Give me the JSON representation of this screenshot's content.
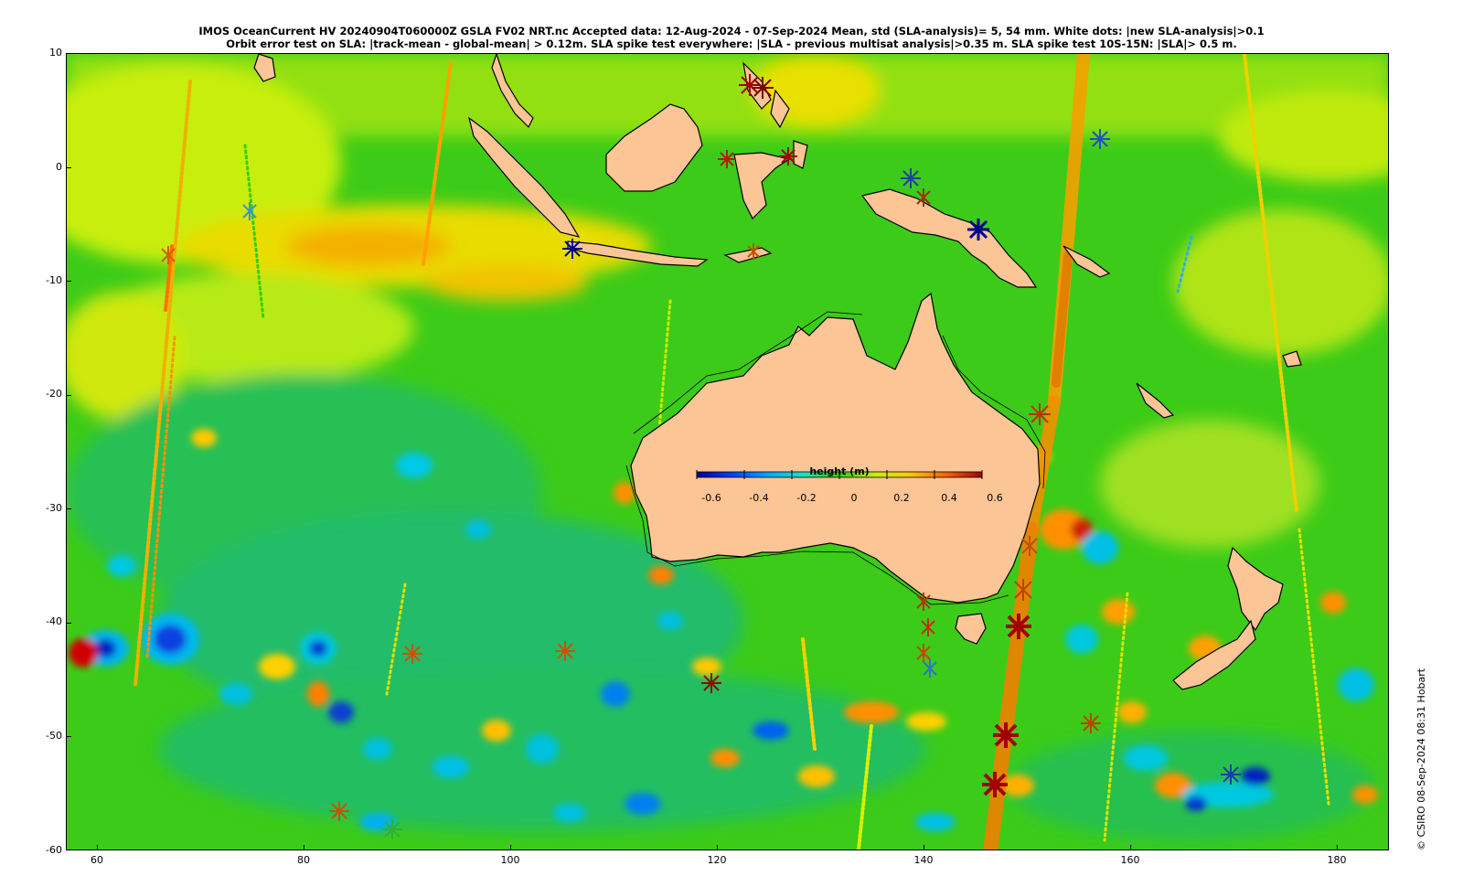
{
  "header": {
    "line1": "IMOS OceanCurrent HV 20240904T060000Z GSLA FV02 NRT.nc  Accepted data: 12-Aug-2024 - 07-Sep-2024 Mean, std (SLA-analysis)= 5, 54 mm. White dots: |new SLA-analysis|>0.1",
    "line2": "Orbit error test on SLA: |track-mean  - global-mean| > 0.12m.  SLA spike test everywhere: |SLA - previous multisat analysis|>0.35 m. SLA spike test 10S-15N: |SLA|> 0.5 m."
  },
  "map": {
    "lon_range": [
      57,
      185
    ],
    "lat_range": [
      -60,
      10
    ],
    "ocean_base_color": "#3dcc1a",
    "land_color": "#fcc596",
    "coast_color": "#000000"
  },
  "axes": {
    "x_ticks": [
      "60",
      "80",
      "100",
      "120",
      "140",
      "160",
      "180"
    ],
    "y_ticks": [
      "10",
      "0",
      "-10",
      "-20",
      "-30",
      "-40",
      "-50",
      "-60"
    ]
  },
  "colorbar": {
    "title": "height (m)",
    "ticks": [
      "-0.6",
      "-0.4",
      "-0.2",
      "0",
      "0.2",
      "0.4",
      "0.6"
    ],
    "colors": [
      "#00008f",
      "#0050ff",
      "#00c8ff",
      "#40e0a0",
      "#2ecc0a",
      "#c8ff00",
      "#ffd000",
      "#ff7800",
      "#b00000"
    ]
  },
  "credit": "© CSIRO 08-Sep-2024 08:31 Hobart"
}
